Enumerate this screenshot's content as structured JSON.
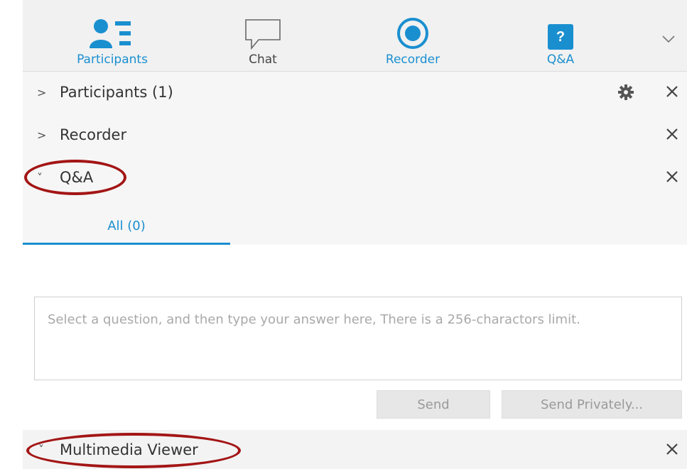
{
  "toolbar": {
    "tabs": [
      {
        "label": "Participants",
        "icon": "participants-icon",
        "color": "#1a8fd0"
      },
      {
        "label": "Chat",
        "icon": "chat-icon",
        "color": "#444444"
      },
      {
        "label": "Recorder",
        "icon": "recorder-icon",
        "color": "#1a8fd0"
      },
      {
        "label": "Q&A",
        "icon": "qa-icon",
        "color": "#1a8fd0"
      }
    ],
    "qa_badge": "?",
    "more_icon": "chevron-down-icon"
  },
  "panel": {
    "sections": [
      {
        "arrow": ">",
        "title": "Participants (1)"
      },
      {
        "arrow": ">",
        "title": "Recorder"
      },
      {
        "arrow": "˅",
        "title": "Q&A"
      }
    ],
    "qa_tab": "All (0)"
  },
  "answer": {
    "placeholder": "Select a question, and then type your answer here, There is a 256-charactors limit."
  },
  "buttons": {
    "send": "Send",
    "send_privately": "Send Privately..."
  },
  "multimedia": {
    "arrow": "˅",
    "title": "Multimedia Viewer"
  },
  "colors": {
    "accent": "#1a8fd0",
    "highlight_ellipse": "#a31515"
  }
}
